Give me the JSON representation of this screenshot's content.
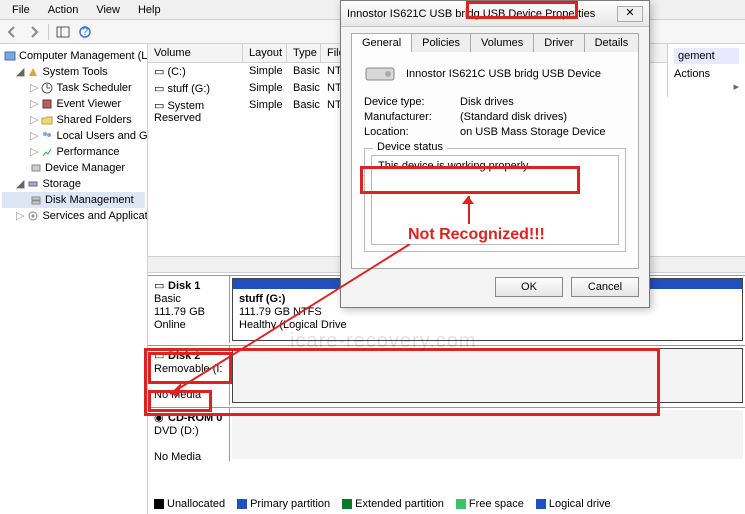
{
  "menu": {
    "file": "File",
    "action": "Action",
    "view": "View",
    "help": "Help"
  },
  "tree": {
    "root": "Computer Management (Local",
    "system_tools": "System Tools",
    "task_scheduler": "Task Scheduler",
    "event_viewer": "Event Viewer",
    "shared_folders": "Shared Folders",
    "local_users": "Local Users and Groups",
    "performance": "Performance",
    "device_manager": "Device Manager",
    "storage": "Storage",
    "disk_management": "Disk Management",
    "services": "Services and Applications"
  },
  "vol_headers": {
    "volume": "Volume",
    "layout": "Layout",
    "type": "Type",
    "fs": "File Sy"
  },
  "volumes": [
    {
      "name": "(C:)",
      "layout": "Simple",
      "type": "Basic",
      "fs": "NTFS"
    },
    {
      "name": "stuff (G:)",
      "layout": "Simple",
      "type": "Basic",
      "fs": "NTFS"
    },
    {
      "name": "System Reserved",
      "layout": "Simple",
      "type": "Basic",
      "fs": "NTFS"
    }
  ],
  "actions": {
    "header": "gement",
    "item": "Actions"
  },
  "disks": {
    "d1": {
      "name": "Disk 1",
      "kind": "Basic",
      "size": "111.79 GB",
      "status": "Online",
      "part_name": "stuff  (G:)",
      "part_size": "111.79 GB NTFS",
      "part_status": "Healthy (Logical Drive"
    },
    "d2": {
      "name": "Disk 2",
      "kind": "Removable (I:",
      "status": "No Media"
    },
    "cd": {
      "name": "CD-ROM 0",
      "kind": "DVD (D:)",
      "status": "No Media"
    }
  },
  "legend": {
    "unalloc": "Unallocated",
    "primary": "Primary partition",
    "ext": "Extended partition",
    "free": "Free space",
    "logical": "Logical drive"
  },
  "dialog": {
    "title_pre": "Innostor IS621C USB bridg USB",
    "title_suf": " Device Properties",
    "tabs": {
      "general": "General",
      "policies": "Policies",
      "volumes": "Volumes",
      "driver": "Driver",
      "details": "Details"
    },
    "device_name": "Innostor IS621C USB bridg USB Device",
    "devtype_k": "Device type:",
    "devtype_v": "Disk drives",
    "manu_k": "Manufacturer:",
    "manu_v": "(Standard disk drives)",
    "loc_k": "Location:",
    "loc_v": "on USB Mass Storage Device",
    "status_label": "Device status",
    "status_text": "This device is working properly.",
    "ok": "OK",
    "cancel": "Cancel"
  },
  "annotation": "Not Recognized!!!",
  "watermark": "icare-recovery.com"
}
